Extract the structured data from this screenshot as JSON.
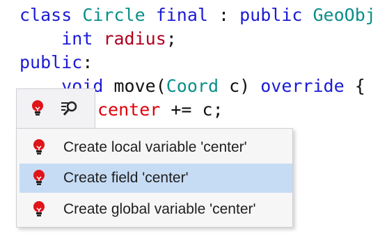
{
  "code": {
    "line1": {
      "kw1": "class",
      "name": "Circle",
      "kw2": "final",
      "colon": " : ",
      "kw3": "public",
      "base": "GeoObj",
      "brace": " {"
    },
    "line2": {
      "indent": "    ",
      "type": "int",
      "field": "radius",
      "semi": ";"
    },
    "line3": {
      "kw": "public",
      "colon": ":"
    },
    "line4": {
      "indent": "    ",
      "kw": "void",
      "fn": " move(",
      "type": "Coord",
      "param": " c) ",
      "kw2": "override",
      "brace": " {"
    },
    "line5": {
      "err": "center",
      "rest": " += c;"
    }
  },
  "action_bar": {
    "bulb_icon": "lightbulb-error-icon",
    "inspect_icon": "inspect-search-icon"
  },
  "quick_fixes": [
    {
      "label": "Create local variable 'center'",
      "icon": "lightbulb-error-icon",
      "selected": false
    },
    {
      "label": "Create field 'center'",
      "icon": "lightbulb-error-icon",
      "selected": true
    },
    {
      "label": "Create global variable 'center'",
      "icon": "lightbulb-error-icon",
      "selected": false
    }
  ],
  "colors": {
    "keyword": "#1b1bd6",
    "type": "#0a8f8a",
    "field": "#b00020",
    "error": "#e0000b",
    "selection": "#c6dcf4"
  }
}
